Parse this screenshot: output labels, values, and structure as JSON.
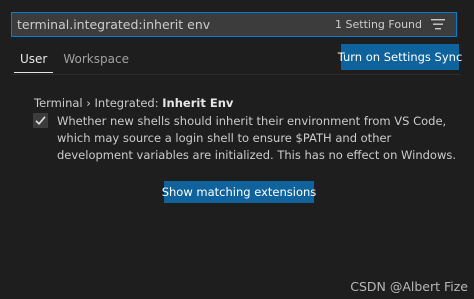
{
  "search": {
    "value": "terminal.integrated:inherit env",
    "result_count": "1 Setting Found",
    "filter_icon": "clear-filter-icon"
  },
  "tabs": [
    {
      "label": "User",
      "active": true
    },
    {
      "label": "Workspace",
      "active": false
    }
  ],
  "sync_button": {
    "label": "Turn on Settings Sync"
  },
  "setting": {
    "category": "Terminal › Integrated: ",
    "name": "Inherit Env",
    "checked": true,
    "check_icon": "checkmark-icon",
    "description": "Whether new shells should inherit their environment from VS Code, which may source a login shell to ensure $PATH and other development variables are initialized. This has no effect on Windows."
  },
  "extensions_button": {
    "label": "Show matching extensions"
  },
  "watermark": "CSDN @Albert Fize",
  "colors": {
    "background": "#1e1e1e",
    "accent_button": "#0e639c",
    "focus_border": "#007fd4"
  }
}
